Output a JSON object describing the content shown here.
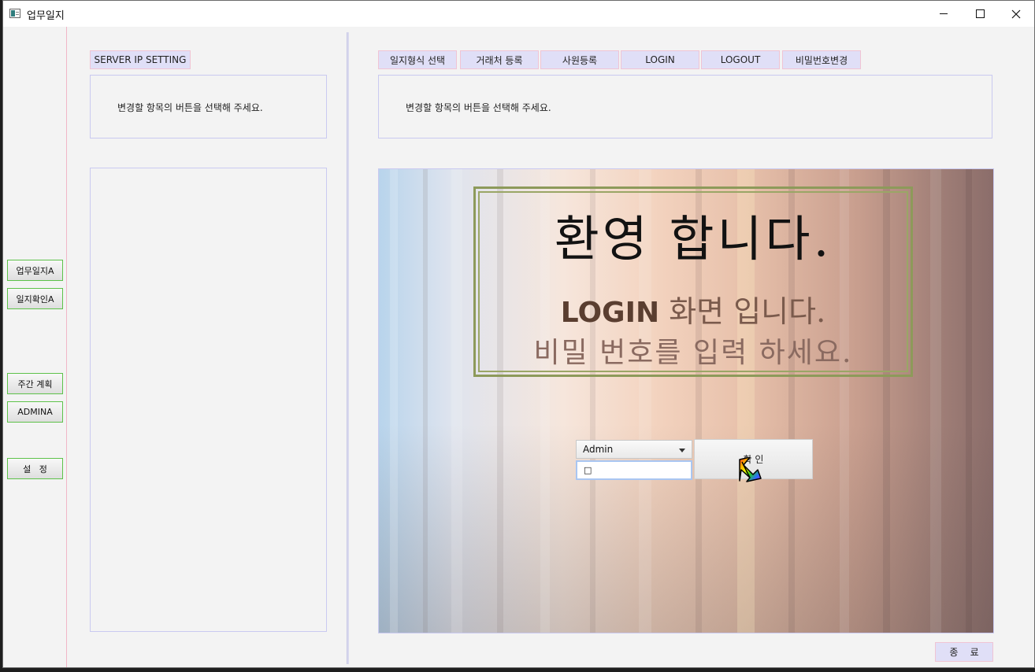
{
  "window": {
    "title": "업무일지",
    "minimize_icon": "minimize-icon",
    "maximize_icon": "maximize-icon",
    "close_icon": "close-icon"
  },
  "sidebar": {
    "items": [
      {
        "label": "업무일지A"
      },
      {
        "label": "일지확인A"
      },
      {
        "label": "주간 계획"
      },
      {
        "label": "ADMINA"
      },
      {
        "label": "설   정"
      }
    ]
  },
  "left_panel": {
    "server_button": "SERVER IP SETTING",
    "message": "변경할 항목의 버튼을 선택해 주세요."
  },
  "right_panel": {
    "tabs": [
      {
        "label": "일지형식 선택"
      },
      {
        "label": "거래처 등록"
      },
      {
        "label": "사원등록"
      },
      {
        "label": "LOGIN"
      },
      {
        "label": "LOGOUT"
      },
      {
        "label": "비밀번호변경"
      }
    ],
    "message": "변경할 항목의 버튼을 선택해 주세요."
  },
  "welcome": {
    "line1": "환영 합니다.",
    "line2_bold": "LOGIN",
    "line2_rest": " 화면 입니다.",
    "line3": "비밀 번호를 입력 하세요."
  },
  "login": {
    "user_select_value": "Admin",
    "password_value": "□",
    "confirm_label": "확 인"
  },
  "footer": {
    "exit_label": "종    료"
  },
  "colors": {
    "tab_bg": "#e0dff7",
    "tab_border": "#f0c4d4",
    "side_btn_border": "#5ec24a",
    "frame_green": "#8d9a5a"
  }
}
